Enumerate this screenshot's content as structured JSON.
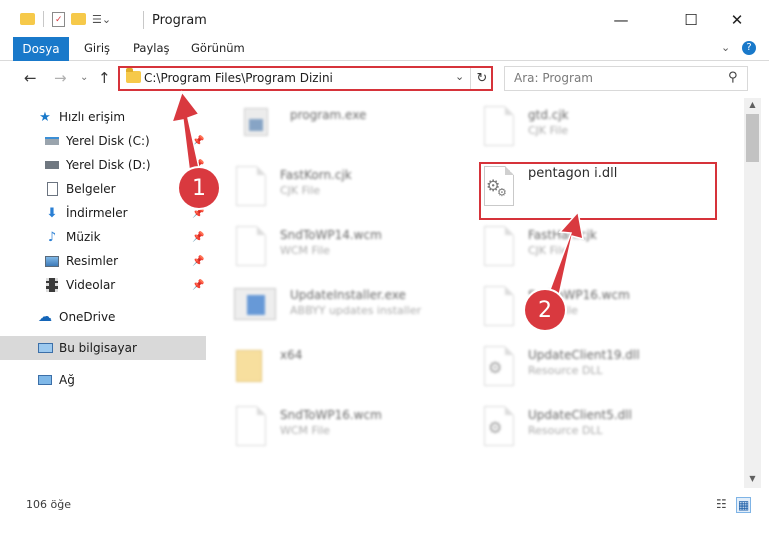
{
  "window": {
    "title": "Program",
    "minimize_glyph": "—",
    "maximize_glyph": "☐",
    "close_glyph": "✕"
  },
  "ribbon": {
    "tabs": [
      {
        "label": "Dosya",
        "active": true
      },
      {
        "label": "Giriş"
      },
      {
        "label": "Paylaş"
      },
      {
        "label": "Görünüm"
      }
    ],
    "collapse_glyph": "⌄",
    "help_glyph": "?"
  },
  "address_bar": {
    "path": "C:\\Program Files\\Program Dizini",
    "dropdown_glyph": "⌄",
    "refresh_glyph": "↻"
  },
  "search": {
    "placeholder": "Ara: Program",
    "icon": "search-icon"
  },
  "nav": {
    "back_glyph": "←",
    "forward_glyph": "→",
    "recent_glyph": "⌄",
    "up_glyph": "↑",
    "items": [
      {
        "label": "Hızlı erişim",
        "icon": "star-icon",
        "pinned": false,
        "selected": false
      },
      {
        "label": "Yerel Disk (C:)",
        "icon": "drive-icon",
        "pinned": true,
        "selected": false
      },
      {
        "label": "Yerel Disk (D:)",
        "icon": "drive-icon",
        "pinned": true,
        "selected": false
      },
      {
        "label": "Belgeler",
        "icon": "documents-icon",
        "pinned": true,
        "selected": false
      },
      {
        "label": "İndirmeler",
        "icon": "download-icon",
        "pinned": true,
        "selected": false
      },
      {
        "label": "Müzik",
        "icon": "music-icon",
        "pinned": true,
        "selected": false
      },
      {
        "label": "Resimler",
        "icon": "pictures-icon",
        "pinned": true,
        "selected": false
      },
      {
        "label": "Videolar",
        "icon": "videos-icon",
        "pinned": true,
        "selected": false
      },
      {
        "label": "OneDrive",
        "icon": "cloud-icon",
        "pinned": false,
        "selected": false
      },
      {
        "label": "Bu bilgisayar",
        "icon": "computer-icon",
        "pinned": false,
        "selected": true
      },
      {
        "label": "Ağ",
        "icon": "network-icon",
        "pinned": false,
        "selected": false
      }
    ]
  },
  "files": [
    {
      "name": "program.exe",
      "type": "",
      "blurred": true
    },
    {
      "name": "gtd.cjk",
      "type": "CJK File",
      "blurred": true
    },
    {
      "name": "FastKorn.cjk",
      "type": "CJK File",
      "blurred": true
    },
    {
      "name": "pentagon i.dll",
      "type": "",
      "blurred": false
    },
    {
      "name": "SndToWP14.wcm",
      "type": "WCM File",
      "blurred": true
    },
    {
      "name": "FastHan.cjk",
      "type": "CJK File",
      "blurred": true
    },
    {
      "name": "UpdateInstaller.exe",
      "type": "ABBYY updates installer",
      "blurred": true
    },
    {
      "name": "SndToWP16.wcm",
      "type": "WCM File",
      "blurred": true
    },
    {
      "name": "x64",
      "type": "",
      "blurred": true
    },
    {
      "name": "UpdateClient19.dll",
      "type": "Resource DLL",
      "blurred": true
    },
    {
      "name": "SndToWP16.wcm",
      "type": "WCM File",
      "blurred": true
    },
    {
      "name": "UpdateClient5.dll",
      "type": "Resource DLL",
      "blurred": true
    }
  ],
  "status": {
    "item_count": "106 öğe"
  },
  "annotations": {
    "callout_1": "1",
    "callout_2": "2",
    "accent_color": "#d9393f"
  },
  "colors": {
    "file_tab": "#1979ca",
    "highlight": "#d6333a",
    "selected_nav": "#d9d9d9"
  }
}
